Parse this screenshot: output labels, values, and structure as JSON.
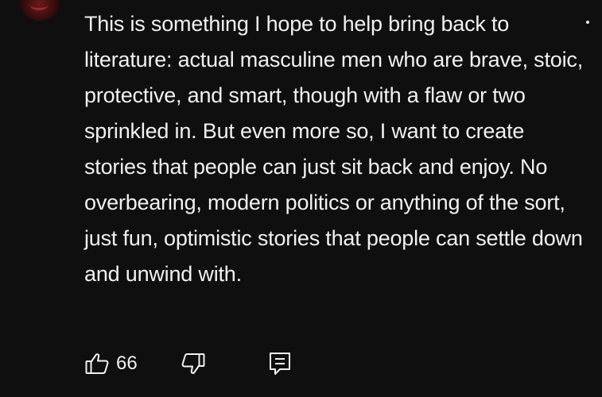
{
  "comment": {
    "text": "This is something I hope to help bring back to literature: actual masculine men who are brave, stoic, protective, and smart, though with a flaw or two sprinkled in. But even more so, I want to create stories that people can just sit back and enjoy. No overbearing, modern politics or anything of the sort, just fun, optimistic stories that people can settle down and unwind with."
  },
  "actions": {
    "like_icon": "thumbs-up-icon",
    "like_count": "66",
    "dislike_icon": "thumbs-down-icon",
    "reply_icon": "reply-comment-icon"
  },
  "colors": {
    "background": "#0f0f0f",
    "text": "#f1f1f1"
  }
}
